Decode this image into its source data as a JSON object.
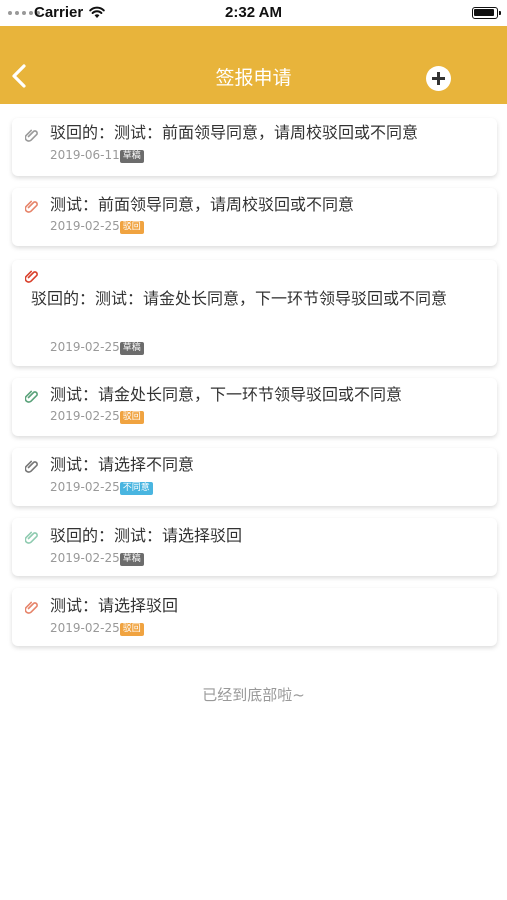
{
  "status_bar": {
    "carrier": "Carrier",
    "time": "2:32 AM"
  },
  "nav": {
    "title": "签报申请",
    "back_icon": "chevron-left-icon",
    "add_icon": "plus-circle-icon"
  },
  "colors": {
    "header": "#e8b43b",
    "badge_draft": "#6c6c6c",
    "badge_rejected": "#f0a340",
    "badge_disagree": "#49b5e0"
  },
  "items": [
    {
      "title": "驳回的：测试：前面领导同意，请周校驳回或不同意",
      "date": "2019-06-11",
      "status": "草稿",
      "clip_color": "#9a9a9a"
    },
    {
      "title": "测试：前面领导同意，请周校驳回或不同意",
      "date": "2019-02-25",
      "status": "驳回",
      "clip_color": "#e6846a"
    },
    {
      "title": "驳回的：测试：请金处长同意，下一环节领导驳回或不同意",
      "date": "2019-02-25",
      "status": "草稿",
      "clip_color": "#d9412c"
    },
    {
      "title": "测试：请金处长同意，下一环节领导驳回或不同意",
      "date": "2019-02-25",
      "status": "驳回",
      "clip_color": "#5aa27a"
    },
    {
      "title": "测试：请选择不同意",
      "date": "2019-02-25",
      "status": "不同意",
      "clip_color": "#777777"
    },
    {
      "title": "驳回的：测试：请选择驳回",
      "date": "2019-02-25",
      "status": "草稿",
      "clip_color": "#8fcbb0"
    },
    {
      "title": "测试：请选择驳回",
      "date": "2019-02-25",
      "status": "驳回",
      "clip_color": "#e6846a"
    }
  ],
  "footer": "已经到底部啦~"
}
